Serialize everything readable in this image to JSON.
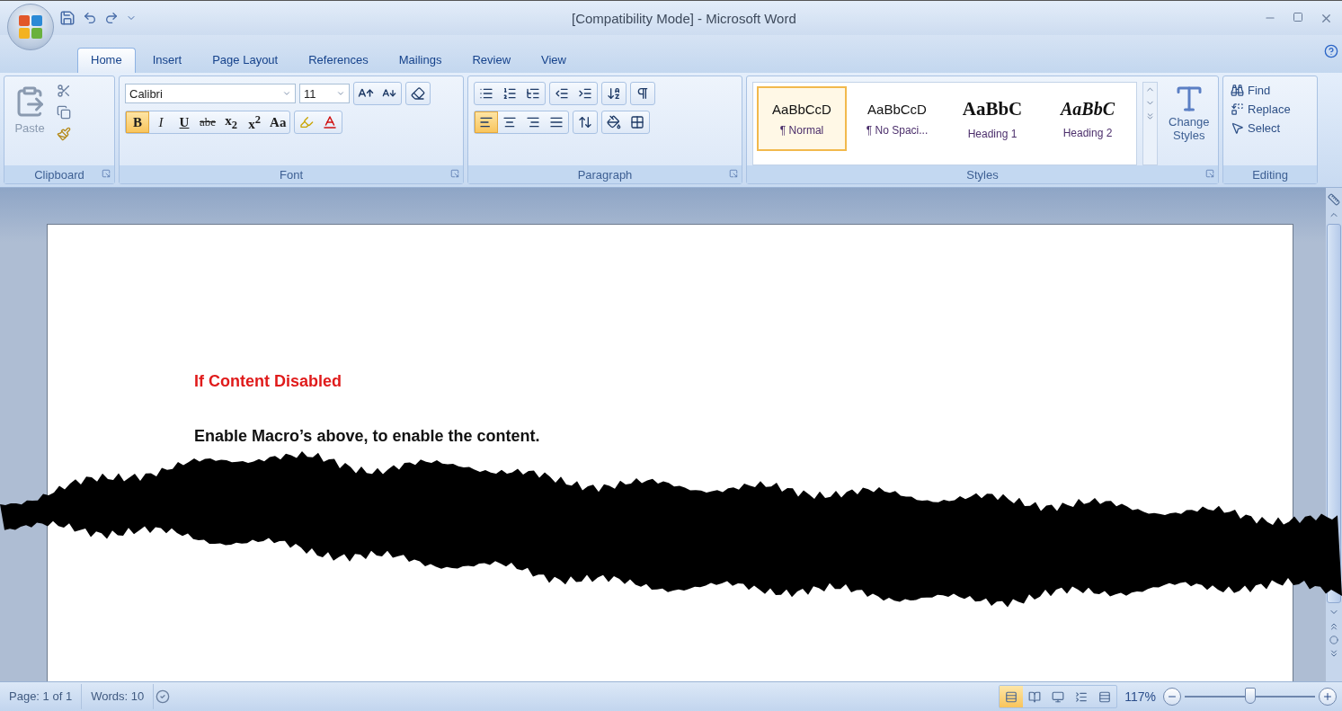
{
  "window": {
    "title": "[Compatibility Mode] - Microsoft Word"
  },
  "tabs": [
    {
      "label": "Home",
      "selected": true
    },
    {
      "label": "Insert",
      "selected": false
    },
    {
      "label": "Page Layout",
      "selected": false
    },
    {
      "label": "References",
      "selected": false
    },
    {
      "label": "Mailings",
      "selected": false
    },
    {
      "label": "Review",
      "selected": false
    },
    {
      "label": "View",
      "selected": false
    }
  ],
  "clipboard": {
    "label": "Clipboard",
    "paste": "Paste"
  },
  "font": {
    "label": "Font",
    "name": "Calibri",
    "size": "11",
    "change_case": "Aa",
    "format_buttons": [
      {
        "kind": "bold",
        "label": "B",
        "selected": true
      },
      {
        "kind": "italic",
        "label": "I",
        "selected": false
      },
      {
        "kind": "underline",
        "label": "U",
        "selected": false
      },
      {
        "kind": "strike",
        "label": "abe",
        "selected": false
      },
      {
        "kind": "plain",
        "label": "x$_{2}$",
        "selected": false
      },
      {
        "kind": "plain",
        "label": "x$^{2}$",
        "selected": false
      }
    ]
  },
  "paragraph": {
    "label": "Paragraph",
    "alignments": [
      {
        "selected": true
      },
      {
        "selected": false
      },
      {
        "selected": false
      },
      {
        "selected": false
      }
    ]
  },
  "styles": {
    "label": "Styles",
    "change_styles": "Change Styles",
    "items": [
      {
        "kind": "normal",
        "preview": "AaBbCcD",
        "name": "¶ Normal",
        "selected": true
      },
      {
        "kind": "normal",
        "preview": "AaBbCcD",
        "name": "¶ No Spaci...",
        "selected": false
      },
      {
        "kind": "heading1",
        "preview": "AaBbC",
        "name": "Heading 1",
        "selected": false
      },
      {
        "kind": "heading2",
        "preview": "AaBbC",
        "name": "Heading 2",
        "selected": false
      }
    ]
  },
  "editing": {
    "label": "Editing",
    "find": "Find",
    "replace": "Replace",
    "select": "Select"
  },
  "document": {
    "paragraphs": [
      {
        "kind": "warning",
        "text": "If Content Disabled"
      },
      {
        "kind": "body",
        "text": "Enable Macro’s above, to enable the content."
      }
    ]
  },
  "status_bar": {
    "page": "Page: 1 of 1",
    "words": "Words: 10",
    "zoom": "117%",
    "views": [
      {
        "selected": true
      },
      {
        "selected": false
      },
      {
        "selected": false
      },
      {
        "selected": false
      },
      {
        "selected": false
      }
    ],
    "zoom_slider": {
      "level": 0.5
    }
  }
}
